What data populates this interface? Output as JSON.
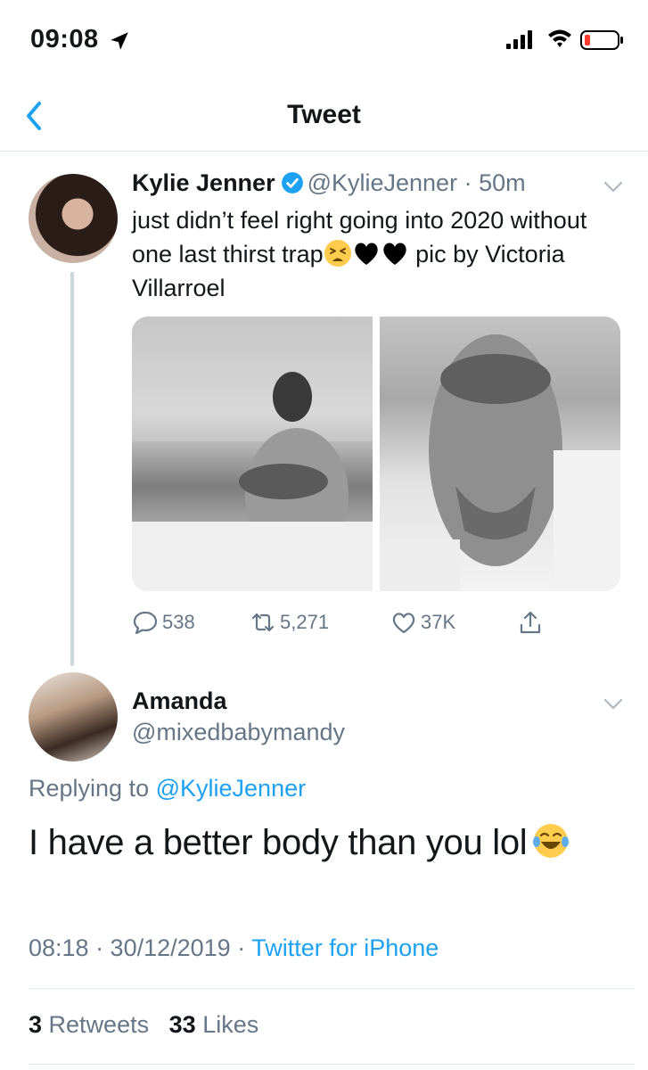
{
  "status_bar": {
    "time": "09:08",
    "icons": [
      "location-arrow-icon",
      "cellular-signal-icon",
      "wifi-icon",
      "battery-low-icon"
    ]
  },
  "header": {
    "title": "Tweet",
    "back_icon": "chevron-left-icon"
  },
  "tweet": {
    "author": "Kylie Jenner",
    "handle": "@KylieJenner",
    "separator": "·",
    "time": "50m",
    "text_parts": [
      "just didn’t feel right going into 2020 without one last thirst trap",
      "pic by Victoria Villarroel"
    ],
    "emojis": [
      "tired-face-emoji",
      "black-heart-emoji",
      "black-heart-emoji"
    ],
    "media_count": 2,
    "actions": {
      "replies": "538",
      "retweets": "5,271",
      "likes": "37K"
    }
  },
  "reply": {
    "author": "Amanda",
    "handle": "@mixedbabymandy",
    "replying_prefix": "Replying to",
    "replying_to": "@KylieJenner",
    "text": "I have a better body than you lol",
    "emoji": "tears-of-joy-emoji",
    "timestamp": "08:18 · 30/12/2019 ·",
    "source": "Twitter for iPhone",
    "retweet_count": "3",
    "retweet_label": "Retweets",
    "like_count": "33",
    "like_label": "Likes"
  },
  "colors": {
    "accent": "#1da1f2",
    "muted": "#657786",
    "text": "#14171a",
    "divider": "#e1e8ed",
    "battery_low": "#ff3b30"
  }
}
